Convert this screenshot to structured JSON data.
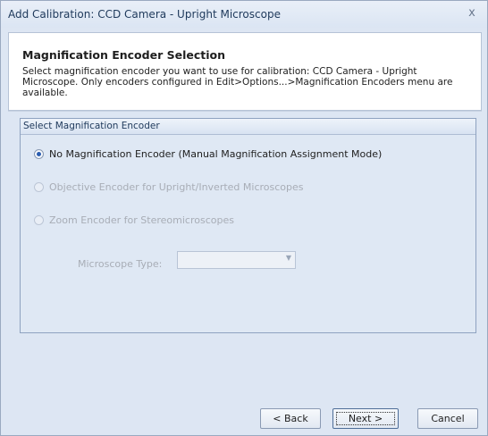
{
  "window": {
    "title": "Add Calibration: CCD Camera - Upright Microscope",
    "close_glyph": "x"
  },
  "header": {
    "title": "Magnification Encoder Selection",
    "description": "Select magnification encoder you want to use for calibration: CCD Camera - Upright Microscope. Only encoders configured in Edit>Options...>Magnification Encoders menu are available."
  },
  "group": {
    "title": "Select Magnification Encoder",
    "options": [
      {
        "label": "No Magnification Encoder (Manual Magnification Assignment Mode)",
        "selected": true,
        "enabled": true
      },
      {
        "label": "Objective Encoder for Upright/Inverted Microscopes",
        "selected": false,
        "enabled": false
      },
      {
        "label": "Zoom Encoder for Stereomicroscopes",
        "selected": false,
        "enabled": false
      }
    ],
    "microscope_type_label": "Microscope Type:",
    "microscope_type_value": ""
  },
  "buttons": {
    "back": "< Back",
    "next": "Next >",
    "cancel": "Cancel"
  }
}
